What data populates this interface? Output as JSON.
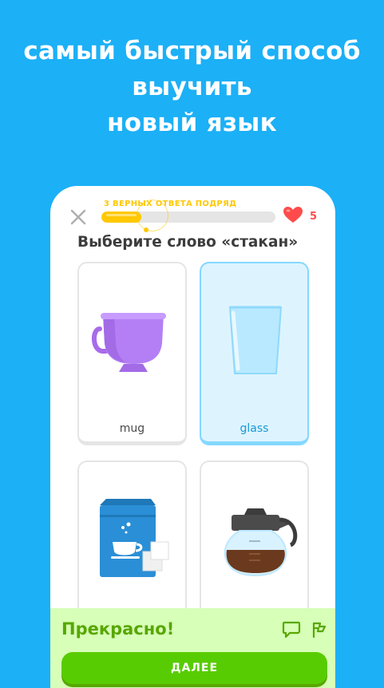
{
  "headline": {
    "line1": "самый быстрый способ",
    "line2": "выучить",
    "line3": "новый язык"
  },
  "lesson": {
    "streak_label": "3 ВЕРНЫХ ОТВЕТА ПОДРЯД",
    "progress_fraction": 0.23,
    "hearts": "5",
    "prompt": "Выберите слово «стакан»",
    "options": [
      {
        "label": "mug",
        "icon": "mug-icon",
        "selected": false
      },
      {
        "label": "glass",
        "icon": "glass-icon",
        "selected": true
      },
      {
        "label": "",
        "icon": "sugar-bag-icon",
        "selected": false
      },
      {
        "label": "",
        "icon": "coffee-pot-icon",
        "selected": false
      }
    ]
  },
  "feedback": {
    "title": "Прекрасно!",
    "continue_label": "ДАЛЕЕ"
  },
  "colors": {
    "background": "#1cb0f6",
    "accent_green": "#58cc02",
    "streak_gold": "#ffc800",
    "heart_red": "#ff4b4b",
    "selected_blue": "#1899d6"
  }
}
